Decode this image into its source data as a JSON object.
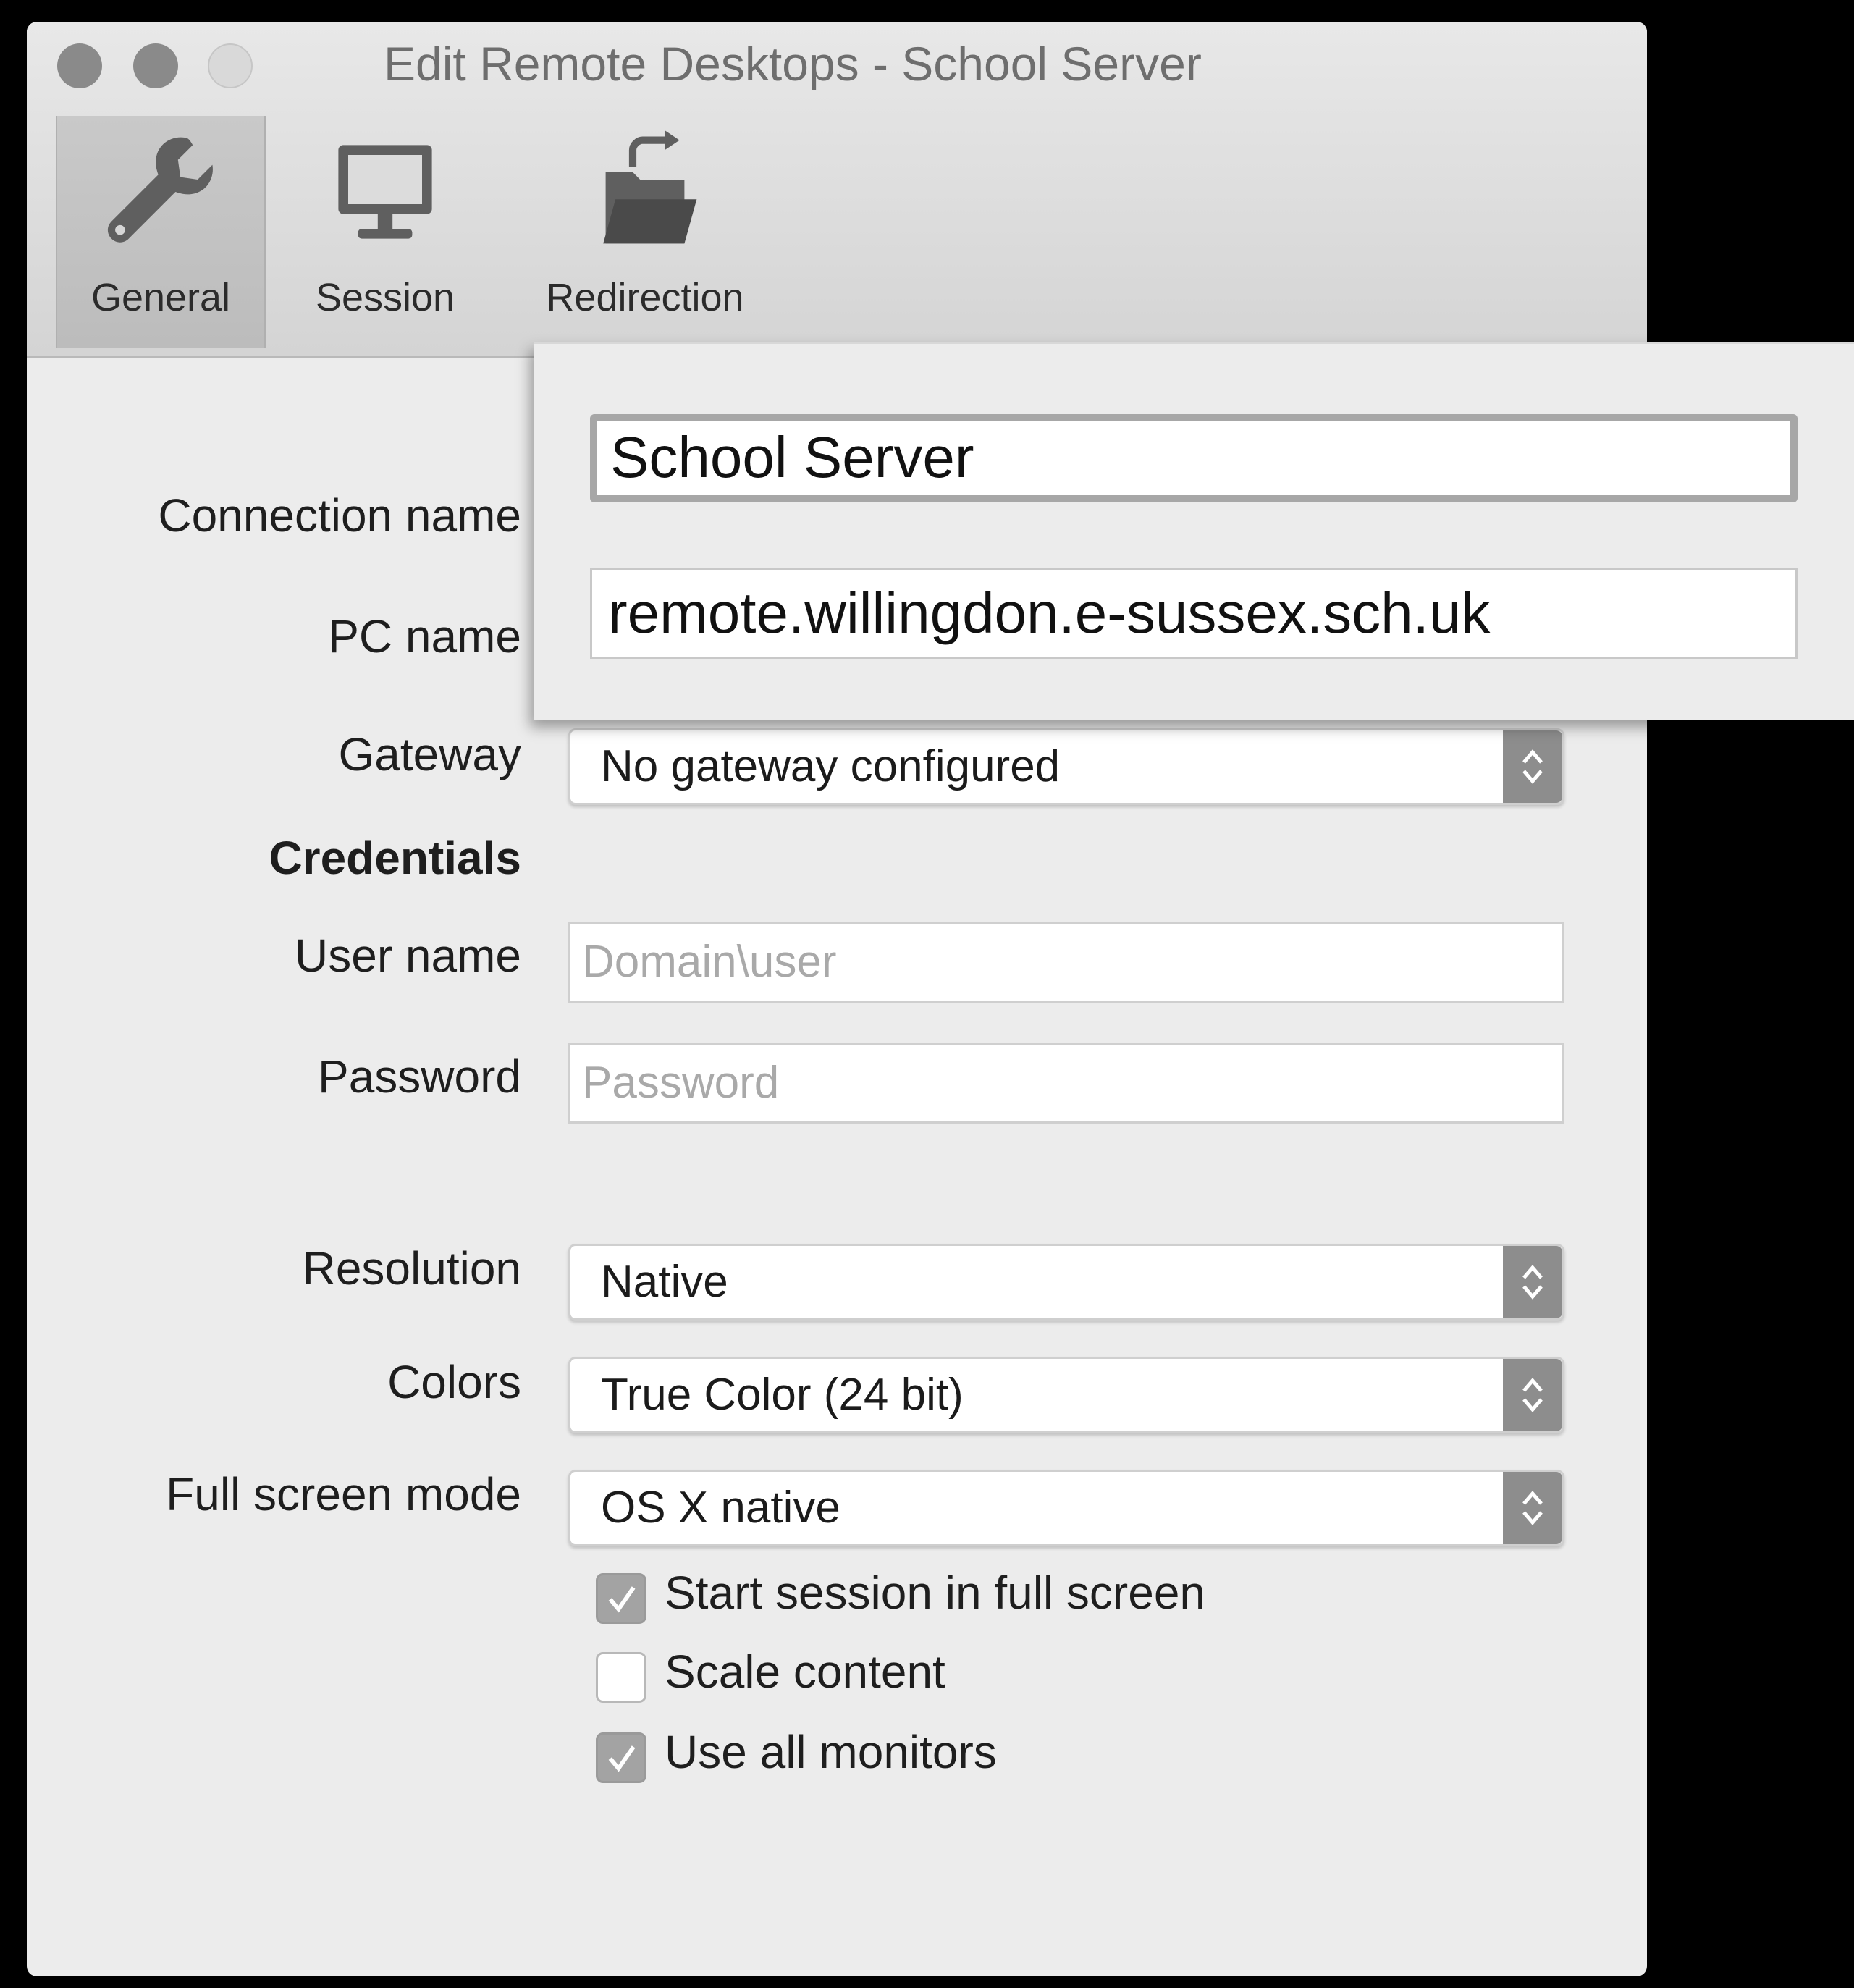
{
  "window": {
    "title": "Edit Remote Desktops - School Server"
  },
  "tabs": [
    {
      "label": "General",
      "icon": "wrench-icon",
      "active": true
    },
    {
      "label": "Session",
      "icon": "monitor-icon",
      "active": false
    },
    {
      "label": "Redirection",
      "icon": "folder-redirect-icon",
      "active": false
    }
  ],
  "form": {
    "connection_name_label": "Connection name",
    "connection_name_value": "School Server",
    "pc_name_label": "PC name",
    "pc_name_value": "remote.willingdon.e-sussex.sch.uk",
    "gateway_label": "Gateway",
    "gateway_value": "No gateway configured",
    "credentials_heading": "Credentials",
    "user_name_label": "User name",
    "user_name_placeholder": "Domain\\user",
    "password_label": "Password",
    "password_placeholder": "Password",
    "resolution_label": "Resolution",
    "resolution_value": "Native",
    "colors_label": "Colors",
    "colors_value": "True Color (24 bit)",
    "full_screen_label": "Full screen mode",
    "full_screen_value": "OS X native"
  },
  "checkboxes": [
    {
      "label": "Start session in full screen",
      "checked": true
    },
    {
      "label": "Scale content",
      "checked": false
    },
    {
      "label": "Use all monitors",
      "checked": true
    }
  ],
  "colors": {
    "window_bg": "#ececec",
    "toolbar_bg": "#d8d8d8",
    "stepper": "#8d8d8d",
    "checked_box": "#a3a3a3"
  }
}
